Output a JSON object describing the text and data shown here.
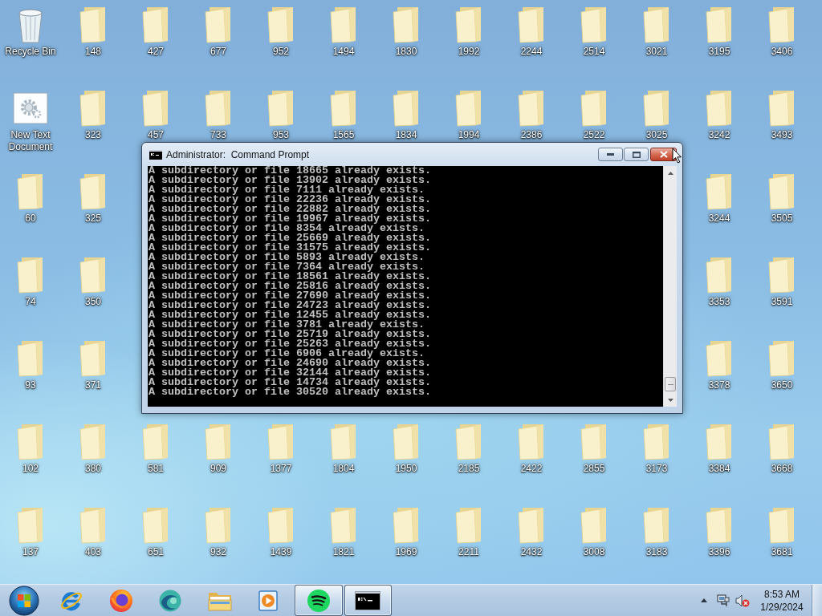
{
  "desktop": {
    "icons": [
      {
        "kind": "recycle-bin",
        "label": "Recycle Bin"
      },
      {
        "kind": "folder",
        "label": "148"
      },
      {
        "kind": "folder",
        "label": "427"
      },
      {
        "kind": "folder",
        "label": "677"
      },
      {
        "kind": "folder",
        "label": "952"
      },
      {
        "kind": "folder",
        "label": "1494"
      },
      {
        "kind": "folder",
        "label": "1830"
      },
      {
        "kind": "folder",
        "label": "1992"
      },
      {
        "kind": "folder",
        "label": "2244"
      },
      {
        "kind": "folder",
        "label": "2514"
      },
      {
        "kind": "folder",
        "label": "3021"
      },
      {
        "kind": "folder",
        "label": "3195"
      },
      {
        "kind": "folder",
        "label": "3406"
      },
      {
        "kind": "text-document",
        "label": "New Text Document"
      },
      {
        "kind": "folder",
        "label": "323"
      },
      {
        "kind": "folder",
        "label": "457"
      },
      {
        "kind": "folder",
        "label": "733"
      },
      {
        "kind": "folder",
        "label": "953"
      },
      {
        "kind": "folder",
        "label": "1565"
      },
      {
        "kind": "folder",
        "label": "1834"
      },
      {
        "kind": "folder",
        "label": "1994"
      },
      {
        "kind": "folder",
        "label": "2386"
      },
      {
        "kind": "folder",
        "label": "2522"
      },
      {
        "kind": "folder",
        "label": "3025"
      },
      {
        "kind": "folder",
        "label": "3242"
      },
      {
        "kind": "folder",
        "label": "3493"
      },
      {
        "kind": "folder",
        "label": "60"
      },
      {
        "kind": "folder",
        "label": "325"
      },
      {
        "kind": "folder",
        "label": "3244"
      },
      {
        "kind": "folder",
        "label": "3505"
      },
      {
        "kind": "folder",
        "label": "74"
      },
      {
        "kind": "folder",
        "label": "350"
      },
      {
        "kind": "folder",
        "label": "3353"
      },
      {
        "kind": "folder",
        "label": "3591"
      },
      {
        "kind": "folder",
        "label": "93"
      },
      {
        "kind": "folder",
        "label": "371"
      },
      {
        "kind": "folder",
        "label": "3378"
      },
      {
        "kind": "folder",
        "label": "3650"
      },
      {
        "kind": "folder",
        "label": "102"
      },
      {
        "kind": "folder",
        "label": "380"
      },
      {
        "kind": "folder",
        "label": "581"
      },
      {
        "kind": "folder",
        "label": "909"
      },
      {
        "kind": "folder",
        "label": "1377"
      },
      {
        "kind": "folder",
        "label": "1804"
      },
      {
        "kind": "folder",
        "label": "1950"
      },
      {
        "kind": "folder",
        "label": "2185"
      },
      {
        "kind": "folder",
        "label": "2422"
      },
      {
        "kind": "folder",
        "label": "2855"
      },
      {
        "kind": "folder",
        "label": "3173"
      },
      {
        "kind": "folder",
        "label": "3384"
      },
      {
        "kind": "folder",
        "label": "3668"
      },
      {
        "kind": "folder",
        "label": "137"
      },
      {
        "kind": "folder",
        "label": "403"
      },
      {
        "kind": "folder",
        "label": "651"
      },
      {
        "kind": "folder",
        "label": "932"
      },
      {
        "kind": "folder",
        "label": "1439"
      },
      {
        "kind": "folder",
        "label": "1821"
      },
      {
        "kind": "folder",
        "label": "1969"
      },
      {
        "kind": "folder",
        "label": "2211"
      },
      {
        "kind": "folder",
        "label": "2432"
      },
      {
        "kind": "folder",
        "label": "3008"
      },
      {
        "kind": "folder",
        "label": "3183"
      },
      {
        "kind": "folder",
        "label": "3396"
      },
      {
        "kind": "folder",
        "label": "3681"
      }
    ]
  },
  "console_window": {
    "title": "Administrator:  Command Prompt",
    "lines": [
      "A subdirectory or file 18665 already exists.",
      "A subdirectory or file 13902 already exists.",
      "A subdirectory or file 7111 already exists.",
      "A subdirectory or file 22236 already exists.",
      "A subdirectory or file 22882 already exists.",
      "A subdirectory or file 19967 already exists.",
      "A subdirectory or file 8354 already exists.",
      "A subdirectory or file 25669 already exists.",
      "A subdirectory or file 31575 already exists.",
      "A subdirectory or file 5893 already exists.",
      "A subdirectory or file 7364 already exists.",
      "A subdirectory or file 18561 already exists.",
      "A subdirectory or file 25816 already exists.",
      "A subdirectory or file 27690 already exists.",
      "A subdirectory or file 24723 already exists.",
      "A subdirectory or file 12455 already exists.",
      "A subdirectory or file 3781 already exists.",
      "A subdirectory or file 25719 already exists.",
      "A subdirectory or file 25263 already exists.",
      "A subdirectory or file 6906 already exists.",
      "A subdirectory or file 24690 already exists.",
      "A subdirectory or file 32144 already exists.",
      "A subdirectory or file 14734 already exists.",
      "A subdirectory or file 30520 already exists."
    ]
  },
  "taskbar": {
    "apps": [
      {
        "kind": "ie",
        "open": false
      },
      {
        "kind": "firefox",
        "open": false
      },
      {
        "kind": "swirl",
        "open": false
      },
      {
        "kind": "files",
        "open": false
      },
      {
        "kind": "player",
        "open": false
      },
      {
        "kind": "music",
        "open": true
      },
      {
        "kind": "terminal",
        "open": true
      }
    ],
    "tray": {
      "volume_muted": true
    },
    "clock": {
      "time": "8:53 AM",
      "date": "1/29/2024"
    }
  }
}
